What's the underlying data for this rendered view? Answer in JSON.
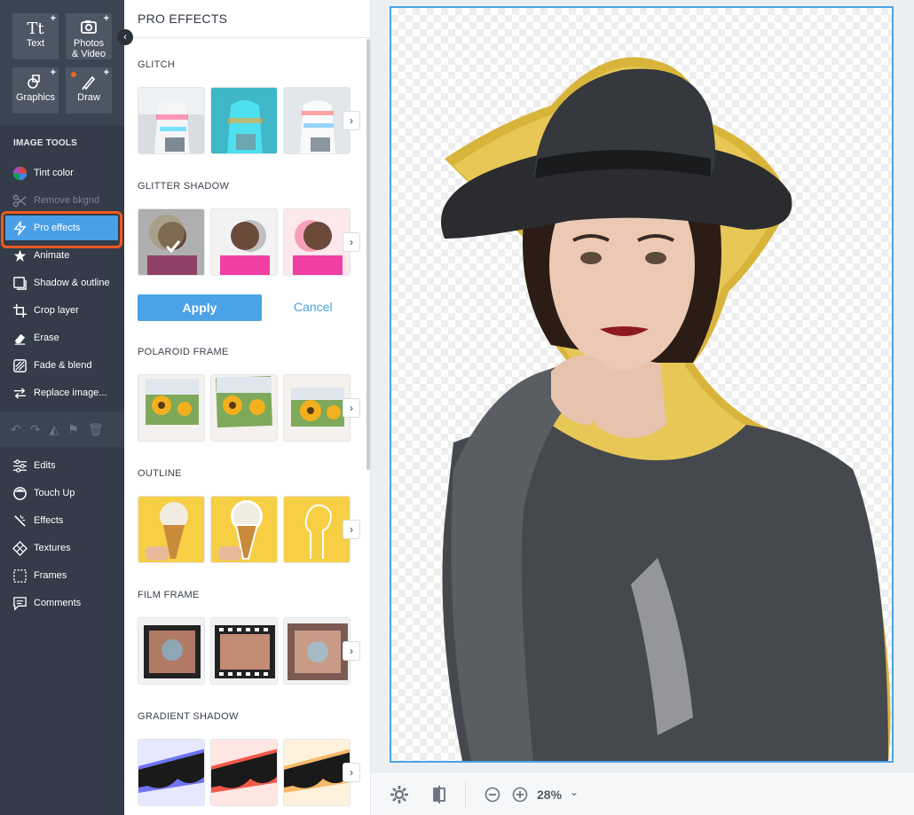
{
  "sidebar": {
    "tiles": [
      {
        "label": "Text",
        "icon": "text-icon",
        "glyph": "Tt"
      },
      {
        "label": "Photos & Video",
        "icon": "photo-icon"
      },
      {
        "label": "Graphics",
        "icon": "graphics-icon"
      },
      {
        "label": "Draw",
        "icon": "draw-icon"
      }
    ],
    "section_title": "IMAGE TOOLS",
    "tools": [
      {
        "label": "Tint color"
      },
      {
        "label": "Remove bkgnd"
      },
      {
        "label": "Pro effects"
      },
      {
        "label": "Animate"
      },
      {
        "label": "Shadow & outline"
      },
      {
        "label": "Crop layer"
      },
      {
        "label": "Erase"
      },
      {
        "label": "Fade & blend"
      },
      {
        "label": "Replace image..."
      }
    ],
    "nav": [
      {
        "label": "Edits"
      },
      {
        "label": "Touch Up"
      },
      {
        "label": "Effects"
      },
      {
        "label": "Textures"
      },
      {
        "label": "Frames"
      },
      {
        "label": "Comments"
      }
    ],
    "collapse_glyph": "‹"
  },
  "panel": {
    "title": "PRO EFFECTS",
    "categories": [
      {
        "title": "GLITCH"
      },
      {
        "title": "GLITTER SHADOW"
      },
      {
        "title": "POLAROID FRAME"
      },
      {
        "title": "OUTLINE"
      },
      {
        "title": "FILM FRAME"
      },
      {
        "title": "GRADIENT SHADOW"
      }
    ],
    "apply_label": "Apply",
    "cancel_label": "Cancel",
    "arrow_glyph": "›"
  },
  "canvas": {
    "zoom": "28%",
    "zoom_caret": "⌄"
  },
  "colors": {
    "accent": "#4aa3e6",
    "highlight": "#f05a22",
    "sidebar": "#333c48"
  }
}
